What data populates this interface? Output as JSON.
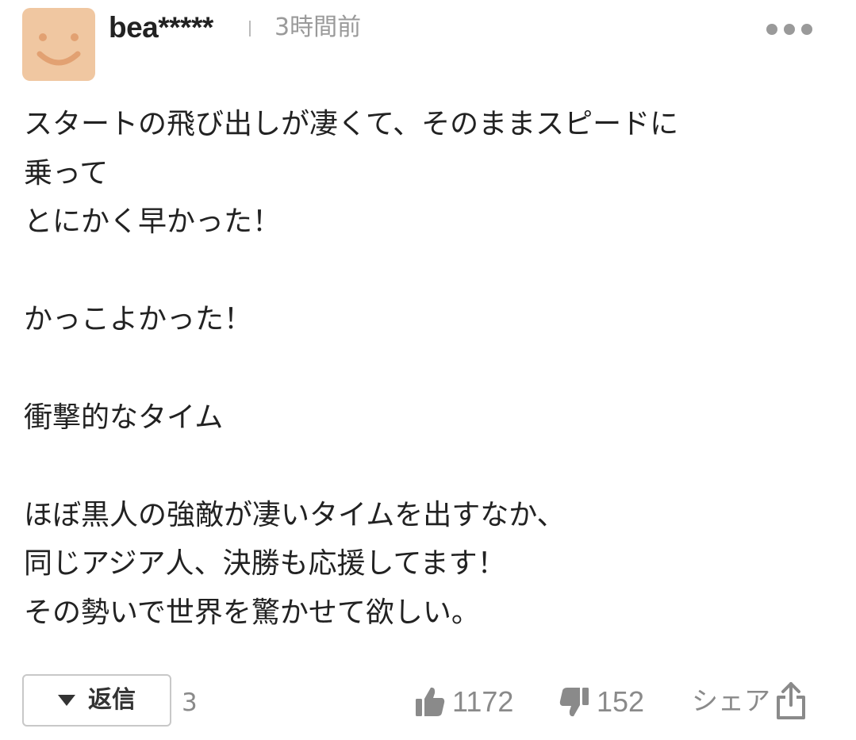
{
  "comment": {
    "user": {
      "name": "bea*****",
      "avatar_icon": "smiley-face-icon",
      "avatar_color": "#f0c7a1"
    },
    "timestamp": "3時間前",
    "more_icon": "more-dots-icon",
    "body": "スタートの飛び出しが凄くて、そのままスピードに\n乗って\nとにかく早かった！\n\nかっこよかった！\n\n衝撃的なタイム\n\nほぼ黒人の強敵が凄いタイムを出すなか、\n同じアジア人、決勝も応援してます！\nその勢いで世界を驚かせて欲しい。"
  },
  "actions": {
    "reply": {
      "label": "返信",
      "icon": "triangle-down-icon",
      "count": "3"
    },
    "like": {
      "icon": "thumbs-up-icon",
      "count": "1172"
    },
    "dislike": {
      "icon": "thumbs-down-icon",
      "count": "152"
    },
    "share": {
      "label": "シェア",
      "icon": "share-icon"
    }
  },
  "colors": {
    "text": "#222222",
    "muted": "#8a8a8a",
    "border": "#c8c8c8"
  }
}
